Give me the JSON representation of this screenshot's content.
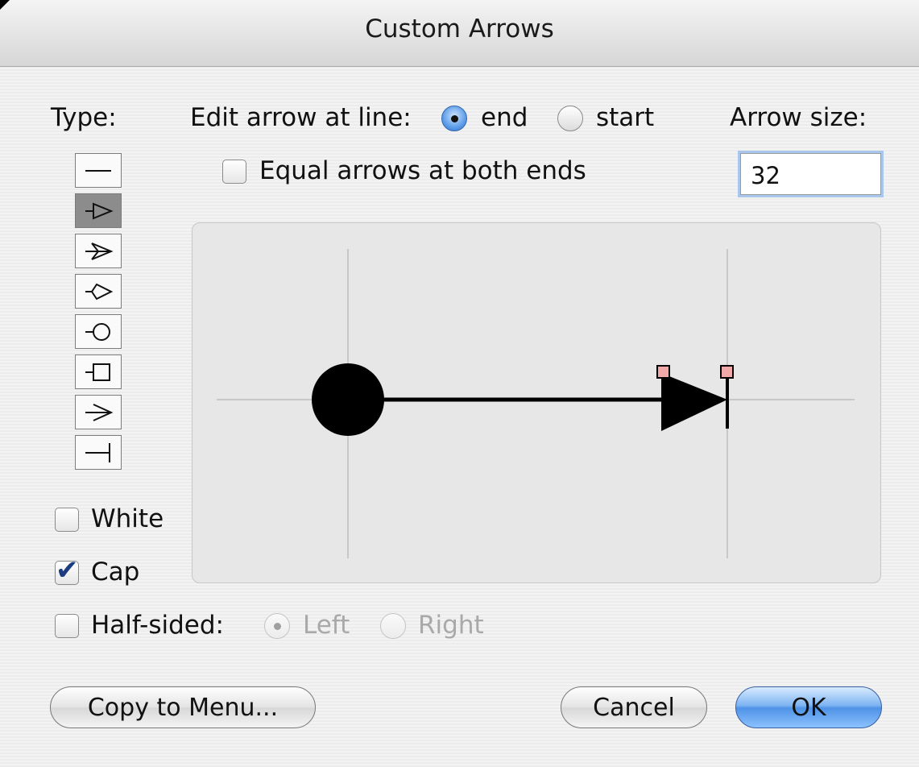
{
  "window": {
    "title": "Custom Arrows"
  },
  "labels": {
    "type": "Type:",
    "edit_arrow": "Edit arrow at line:",
    "end": "end",
    "start": "start",
    "arrow_size": "Arrow size:",
    "equal_arrows": "Equal arrows at both ends",
    "white": "White",
    "cap": "Cap",
    "half_sided": "Half-sided:",
    "left": "Left",
    "right": "Right"
  },
  "arrow_size_value": "32",
  "state": {
    "edit_at": "end",
    "equal_arrows": false,
    "white": false,
    "cap": true,
    "half_sided": false,
    "half_side": "Left",
    "selected_type_index": 1
  },
  "arrow_types": [
    "line-icon",
    "triangle-arrow-icon",
    "open-arrow-icon",
    "pointed-shape-icon",
    "circle-icon",
    "square-icon",
    "v-arrow-icon",
    "bar-icon"
  ],
  "buttons": {
    "copy_to_menu": "Copy to Menu...",
    "cancel": "Cancel",
    "ok": "OK"
  },
  "colors": {
    "accent": "#4f92e6",
    "handle": "#f0a8a8"
  }
}
